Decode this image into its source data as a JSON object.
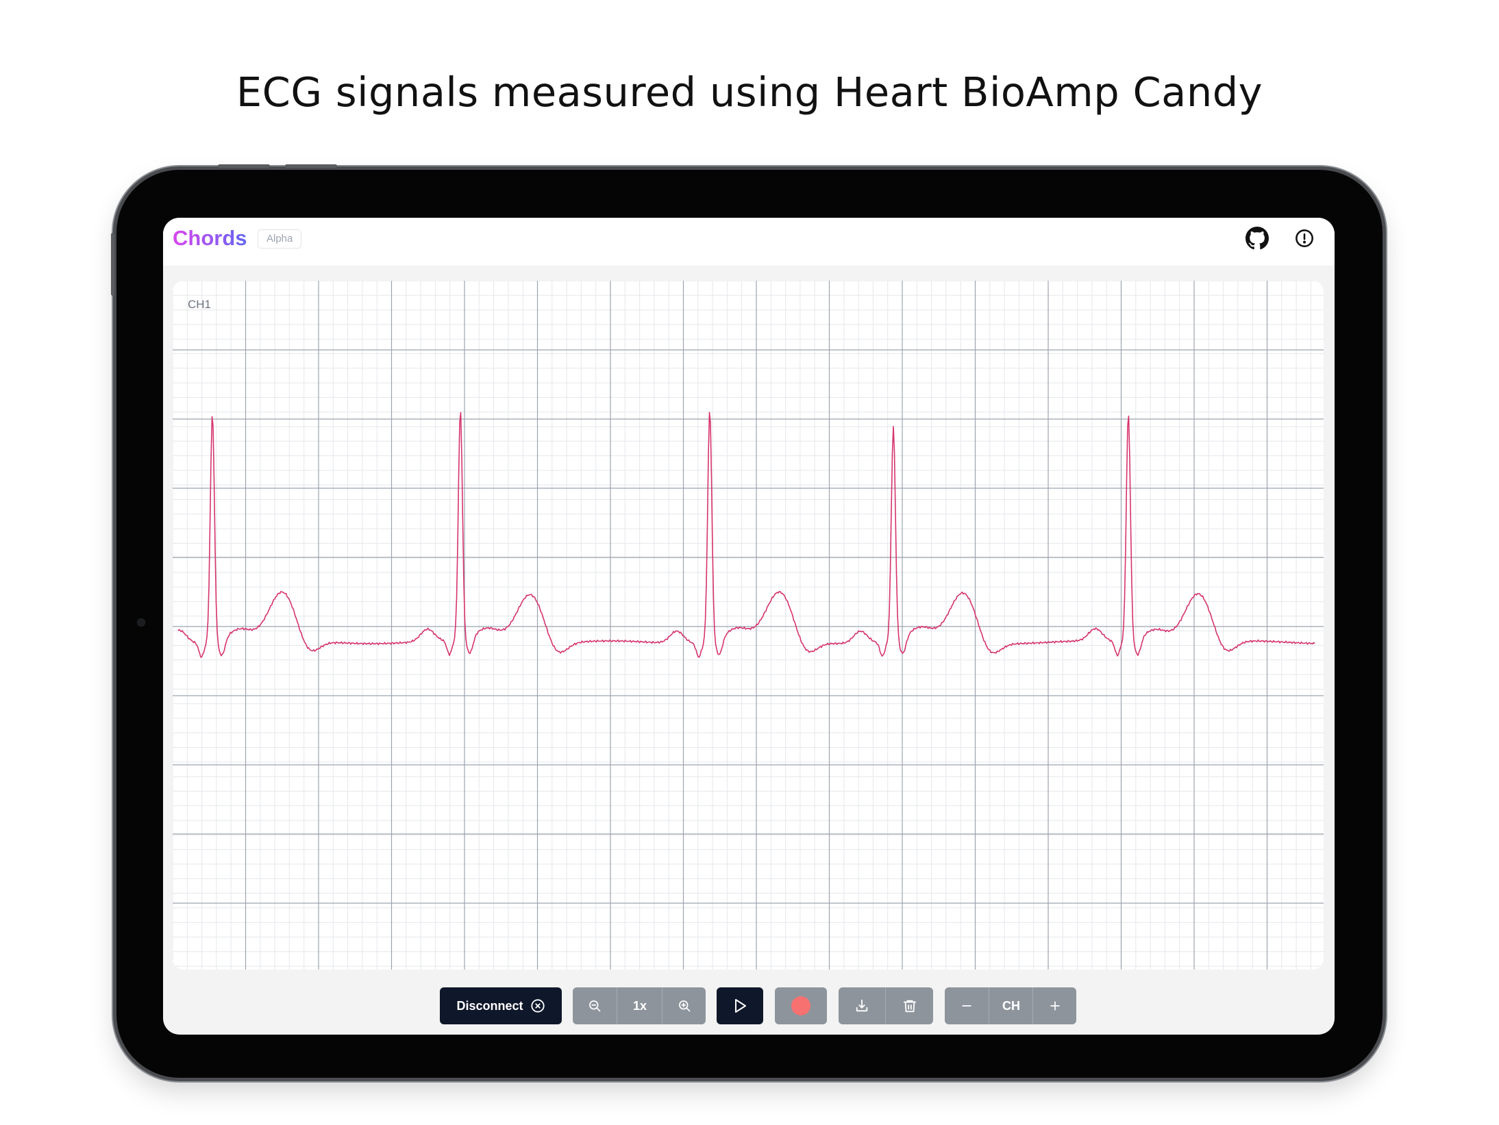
{
  "headline": "ECG signals measured using Heart BioAmp Candy",
  "app": {
    "brand": "Chords",
    "badge": "Alpha"
  },
  "topbar_icons": [
    "github-icon",
    "info-icon"
  ],
  "channel": {
    "label": "CH1",
    "trace_color": "#d6336c",
    "beats": 5
  },
  "toolbar": {
    "disconnect_label": "Disconnect",
    "zoom_level": "1x",
    "channel_label": "CH",
    "record_color": "#f87171",
    "icons": [
      "close-circle-icon",
      "zoom-out-icon",
      "zoom-in-icon",
      "play-icon",
      "record-icon",
      "download-icon",
      "trash-icon",
      "minus-icon",
      "plus-icon"
    ]
  },
  "colors": {
    "dark_button": "#0f172a",
    "gray_button": "#8e949c",
    "grid_major": "#9ca3af",
    "grid_minor": "#e5e7eb"
  }
}
